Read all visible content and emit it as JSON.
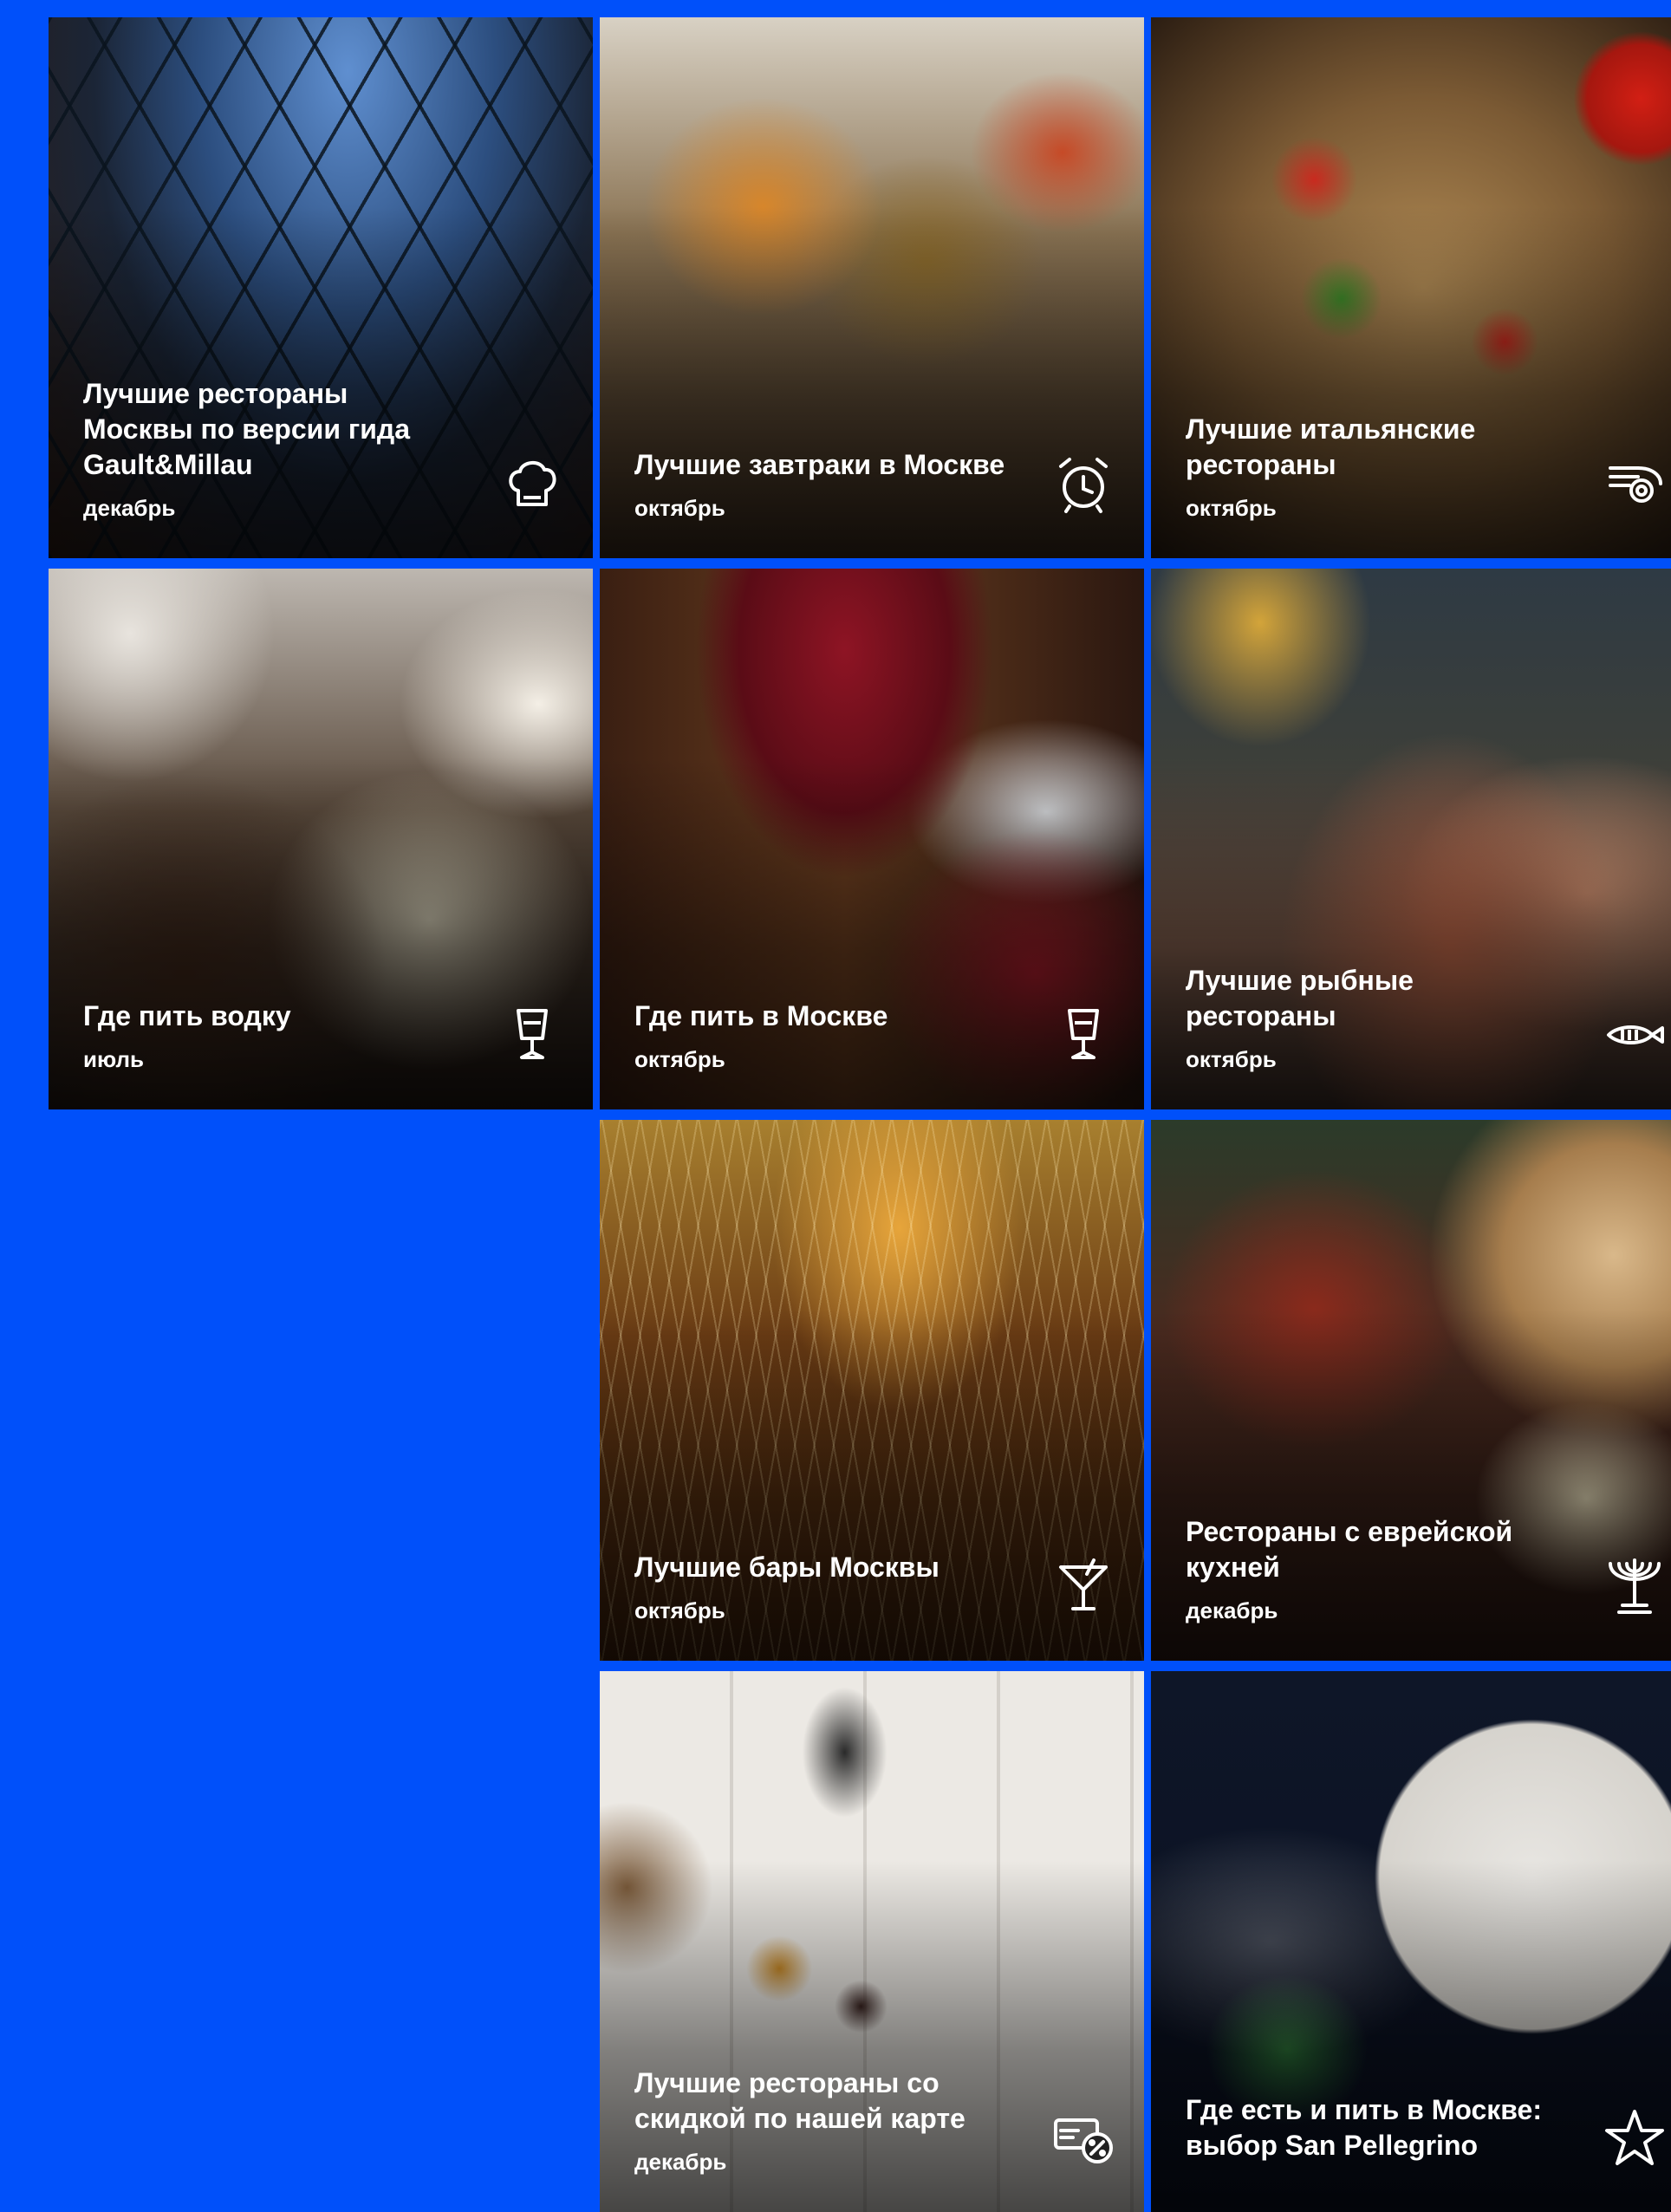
{
  "colors": {
    "background": "#0050fa",
    "text": "#ffffff"
  },
  "tiles": [
    {
      "title": "Лучшие рестораны Москвы по версии гида Gault&Millau",
      "month": "декабрь",
      "icon": "chef-hat-icon"
    },
    {
      "title": "Лучшие завтраки в Москве",
      "month": "октябрь",
      "icon": "alarm-clock-icon"
    },
    {
      "title": "Лучшие итальянские рестораны",
      "month": "октябрь",
      "icon": "pasta-fork-icon"
    },
    {
      "title": "Где пить водку",
      "month": "июль",
      "icon": "shot-glass-icon"
    },
    {
      "title": "Где пить в Москве",
      "month": "октябрь",
      "icon": "shot-glass-icon"
    },
    {
      "title": "Лучшие рыбные рестораны",
      "month": "октябрь",
      "icon": "fish-icon"
    },
    {
      "title": "Лучшие бары Москвы",
      "month": "октябрь",
      "icon": "martini-glass-icon"
    },
    {
      "title": "Рестораны с еврейской кухней",
      "month": "декабрь",
      "icon": "menorah-icon"
    },
    {
      "title": "Лучшие рестораны со скидкой по нашей карте",
      "month": "декабрь",
      "icon": "discount-card-icon"
    },
    {
      "title": "Где есть и пить в Москве: выбор San Pellegrino",
      "month": "",
      "icon": "star-icon"
    }
  ]
}
